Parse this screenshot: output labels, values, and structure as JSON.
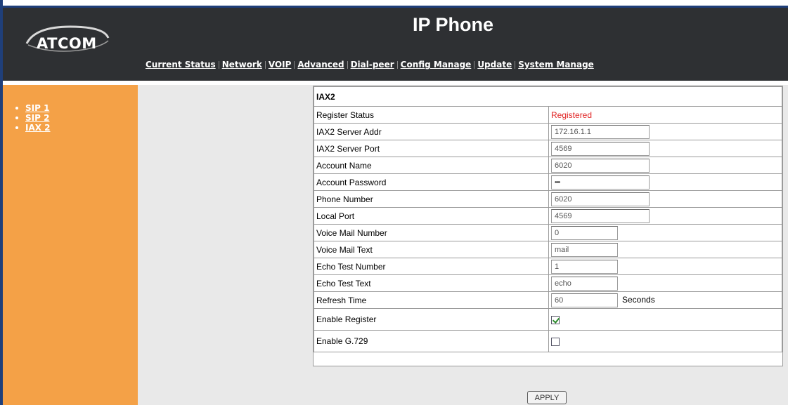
{
  "header": {
    "brand": "ATCOM",
    "title": "IP Phone",
    "nav": [
      {
        "label": "Current Status"
      },
      {
        "label": "Network"
      },
      {
        "label": "VOIP"
      },
      {
        "label": "Advanced"
      },
      {
        "label": "Dial-peer"
      },
      {
        "label": "Config Manage"
      },
      {
        "label": "Update"
      },
      {
        "label": "System Manage"
      }
    ]
  },
  "sidebar": {
    "items": [
      {
        "label": "SIP 1"
      },
      {
        "label": "SIP 2"
      },
      {
        "label": "IAX 2"
      }
    ]
  },
  "form": {
    "section_title": "IAX2",
    "register_status": {
      "label": "Register Status",
      "value": "Registered",
      "color": "#e02020"
    },
    "server_addr": {
      "label": "IAX2 Server Addr",
      "value": "172.16.1.1"
    },
    "server_port": {
      "label": "IAX2 Server Port",
      "value": "4569"
    },
    "account_name": {
      "label": "Account Name",
      "value": "6020"
    },
    "account_password": {
      "label": "Account Password",
      "value": "••••"
    },
    "phone_number": {
      "label": "Phone Number",
      "value": "6020"
    },
    "local_port": {
      "label": "Local Port",
      "value": "4569"
    },
    "voice_mail_number": {
      "label": "Voice Mail Number",
      "value": "0"
    },
    "voice_mail_text": {
      "label": "Voice Mail Text",
      "value": "mail"
    },
    "echo_test_number": {
      "label": "Echo Test Number",
      "value": "1"
    },
    "echo_test_text": {
      "label": "Echo Test Text",
      "value": "echo"
    },
    "refresh_time": {
      "label": "Refresh Time",
      "value": "60",
      "unit": "Seconds"
    },
    "enable_register": {
      "label": "Enable Register",
      "checked": true
    },
    "enable_g729": {
      "label": "Enable G.729",
      "checked": false
    }
  },
  "actions": {
    "apply_label": "APPLY"
  },
  "colors": {
    "header_bg": "#2e3033",
    "sidebar_bg": "#f4a147",
    "content_bg": "#e9e9e9",
    "frame_blue": "#1f3f7a"
  }
}
